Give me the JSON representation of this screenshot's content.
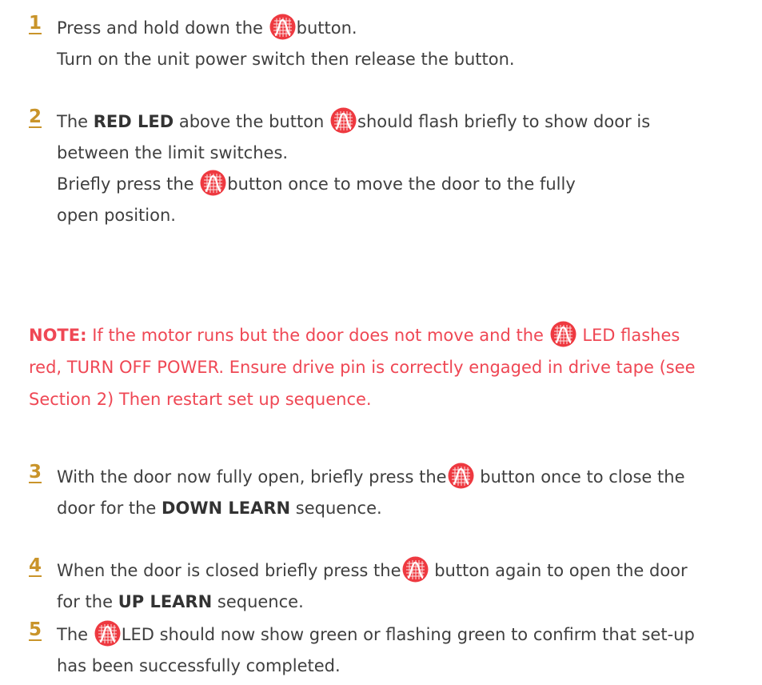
{
  "colors": {
    "step_number": "#c9942a",
    "body_text": "#3f3f3f",
    "note_text": "#ef4754",
    "icon_fill": "#ee3940",
    "icon_lines": "#ffffff"
  },
  "icon_name": "door-learn-button-icon",
  "steps": [
    {
      "number": "1",
      "lines": [
        {
          "a": "Press and hold down the",
          "b": "button."
        },
        {
          "a": "Turn on the unit power switch then release the button."
        }
      ]
    },
    {
      "number": "2",
      "lines": [
        {
          "pre": "The",
          "bold": "RED LED",
          "a": "above the button",
          "b": "should flash briefly to show door is"
        },
        {
          "a": "between the limit switches."
        },
        {
          "a": "Briefly press the",
          "b": "button once to move the door to the fully"
        },
        {
          "a": "open position."
        }
      ]
    },
    {
      "number": "3",
      "lines": [
        {
          "a": "With the door now fully open, briefly press the",
          "b": "button once to close the"
        },
        {
          "pre": "door for the",
          "bold": "DOWN LEARN",
          "post": "sequence."
        }
      ]
    },
    {
      "number": "4",
      "lines": [
        {
          "a": "When the door is closed briefly press the",
          "b": "button again to open the door"
        },
        {
          "pre": "for the",
          "bold": "UP LEARN",
          "post": "sequence."
        }
      ]
    },
    {
      "number": "5",
      "lines": [
        {
          "a": "The",
          "b": "LED should now show green or flashing green to confirm that set-up"
        },
        {
          "a": "has been successfully completed."
        }
      ]
    }
  ],
  "note": {
    "label": "NOTE:",
    "line1_a": "If the motor runs but the door does not move and the",
    "line1_b": "LED flashes",
    "line2": "red, TURN OFF POWER. Ensure drive pin is correctly engaged in drive tape (see",
    "line3": "Section 2) Then restart set up sequence."
  }
}
